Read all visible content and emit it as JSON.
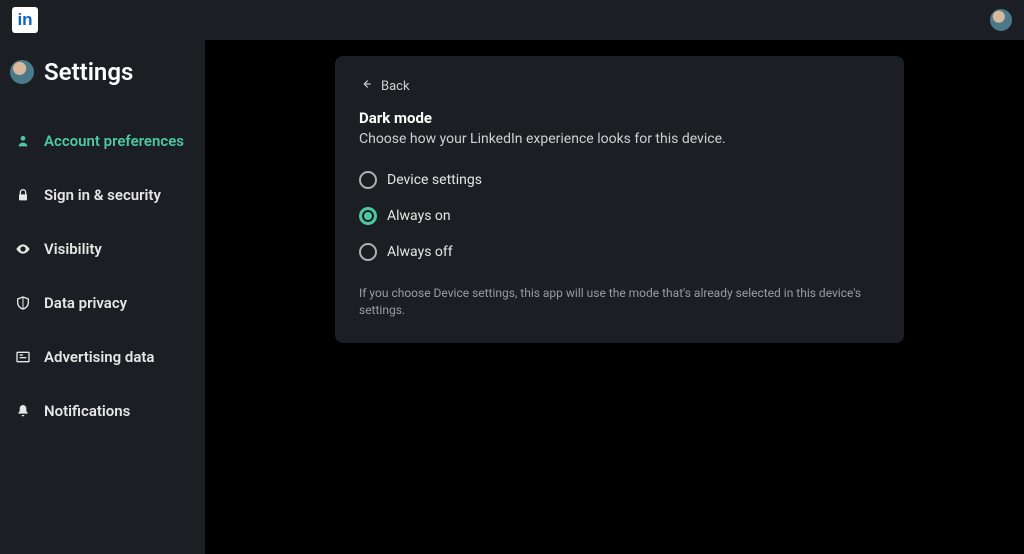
{
  "header": {
    "page_title": "Settings"
  },
  "sidebar": {
    "items": [
      {
        "id": "account-preferences",
        "label": "Account preferences",
        "active": true
      },
      {
        "id": "sign-in-security",
        "label": "Sign in & security",
        "active": false
      },
      {
        "id": "visibility",
        "label": "Visibility",
        "active": false
      },
      {
        "id": "data-privacy",
        "label": "Data privacy",
        "active": false
      },
      {
        "id": "advertising-data",
        "label": "Advertising data",
        "active": false
      },
      {
        "id": "notifications",
        "label": "Notifications",
        "active": false
      }
    ]
  },
  "panel": {
    "back_label": "Back",
    "title": "Dark mode",
    "subtitle": "Choose how your LinkedIn experience looks for this device.",
    "note": "If you choose Device settings, this app will use the mode that's already selected in this device's settings.",
    "options": [
      {
        "id": "device-settings",
        "label": "Device settings",
        "selected": false
      },
      {
        "id": "always-on",
        "label": "Always on",
        "selected": true
      },
      {
        "id": "always-off",
        "label": "Always off",
        "selected": false
      }
    ]
  }
}
